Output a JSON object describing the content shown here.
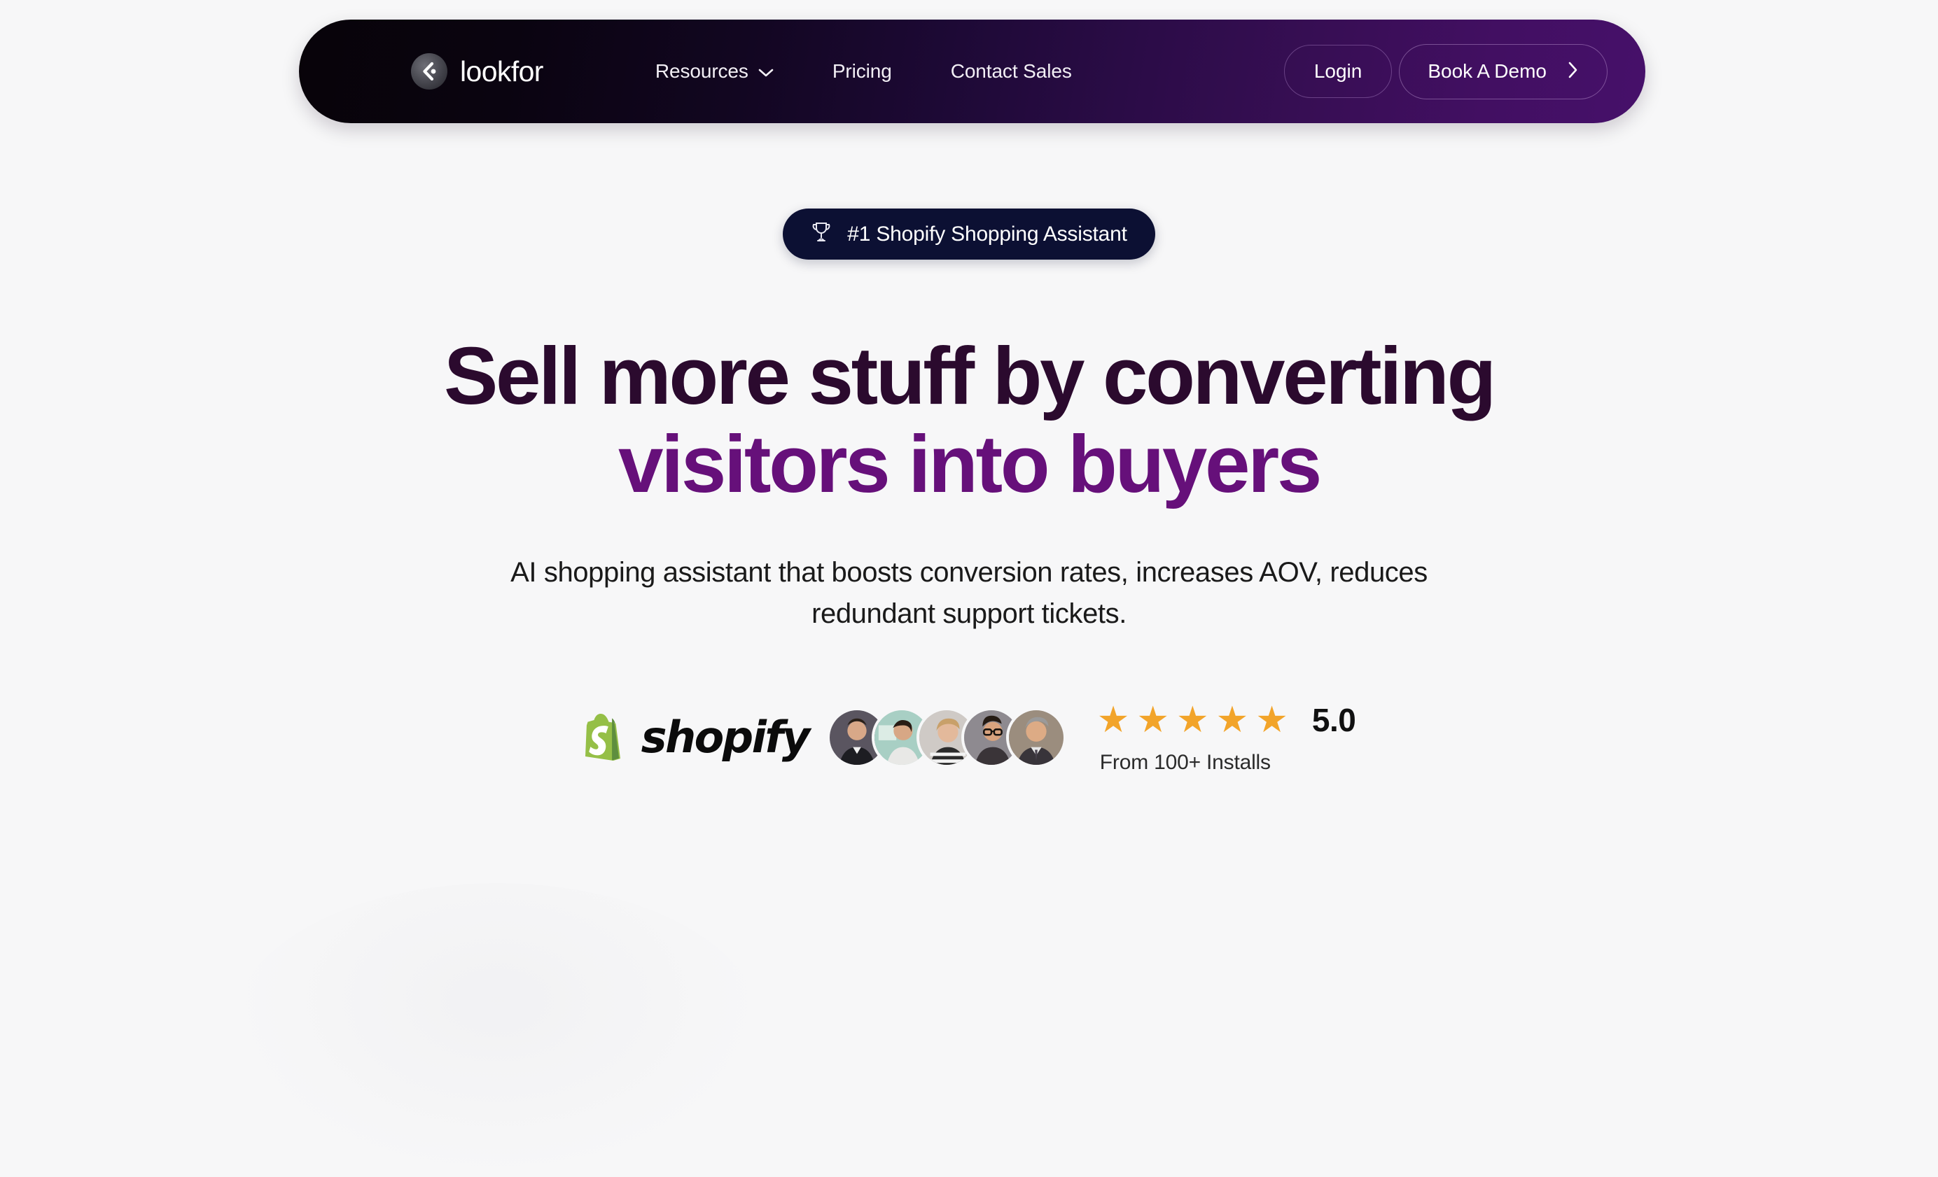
{
  "page": {
    "background_color": "#f7f7f8"
  },
  "navbar": {
    "brand": {
      "name": "lookfor",
      "mark_icon": "chevron-left-dot-logo-icon"
    },
    "links": [
      {
        "label": "Resources",
        "has_dropdown": true,
        "dropdown_icon": "chevron-down-icon"
      },
      {
        "label": "Pricing",
        "has_dropdown": false
      },
      {
        "label": "Contact Sales",
        "has_dropdown": false
      }
    ],
    "login_label": "Login",
    "demo_label": "Book A Demo",
    "demo_icon": "chevron-right-icon",
    "gradient_from": "#080309",
    "gradient_to": "#46106a"
  },
  "hero": {
    "badge": {
      "icon": "trophy-icon",
      "text": "#1 Shopify Shopping Assistant",
      "background_color": "#0c1033"
    },
    "headline_line1": "Sell more stuff by converting",
    "headline_line2": "visitors into buyers",
    "headline_color_line1": "#2b0a2e",
    "headline_color_line2": "#66107a",
    "subheadline": "AI shopping assistant that boosts conversion rates, increases AOV, reduces redundant support tickets."
  },
  "social_proof": {
    "shopify": {
      "wordmark": "shopify",
      "bag_color": "#95bf47",
      "icon": "shopify-bag-icon"
    },
    "avatars": [
      {
        "name": "avatar-1",
        "skin": "#d8a888",
        "hair": "#2a2018",
        "clothes": "#1d1d22",
        "bg": "#5a5560"
      },
      {
        "name": "avatar-2",
        "skin": "#d7a785",
        "hair": "#281c14",
        "clothes": "#e8e8e6",
        "bg": "#a8cfc4"
      },
      {
        "name": "avatar-3",
        "skin": "#e3b99b",
        "hair": "#c8a06a",
        "clothes": "#2b2b2b",
        "bg": "#cfcac6"
      },
      {
        "name": "avatar-4",
        "skin": "#d9a37e",
        "hair": "#241a13",
        "clothes": "#3a3438",
        "bg": "#8e8a90"
      },
      {
        "name": "avatar-5",
        "skin": "#ddab85",
        "hair": "#9a9a9a",
        "clothes": "#38343a",
        "bg": "#9b8d7e"
      }
    ],
    "rating": {
      "stars": 5,
      "star_glyph": "★",
      "star_color": "#f2a42a",
      "score": "5.0",
      "caption": "From 100+ Installs"
    }
  }
}
